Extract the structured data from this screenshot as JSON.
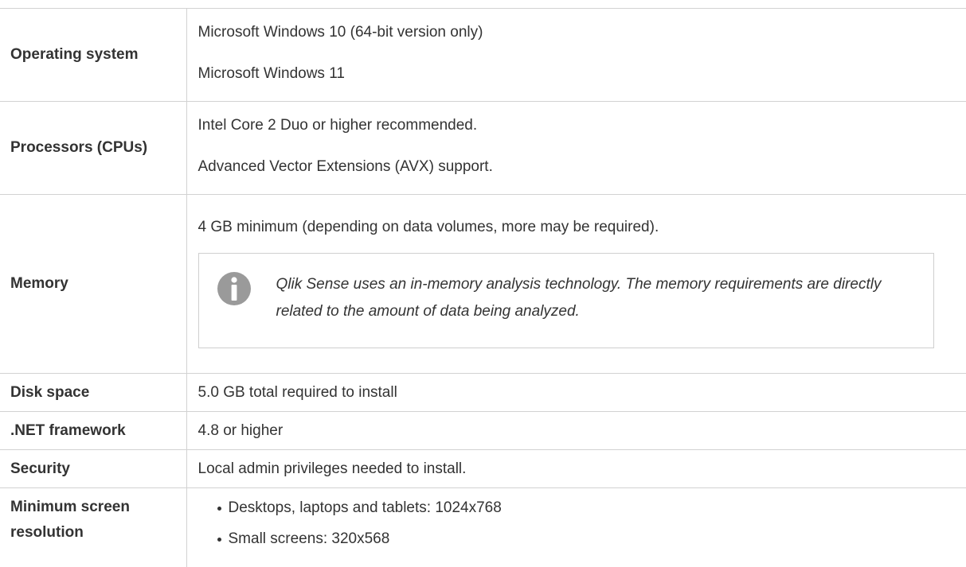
{
  "requirements": {
    "os": {
      "label": "Operating system",
      "values": [
        "Microsoft Windows 10 (64-bit version only)",
        "Microsoft Windows 11"
      ]
    },
    "cpu": {
      "label": "Processors (CPUs)",
      "values": [
        "Intel Core 2 Duo or higher recommended.",
        "Advanced Vector Extensions (AVX) support."
      ]
    },
    "memory": {
      "label": "Memory",
      "value": "4 GB minimum (depending on data volumes, more may be required).",
      "note": "Qlik Sense uses an in-memory analysis technology. The memory requirements are directly related to the amount of data being analyzed.",
      "note_icon": "info-icon"
    },
    "disk": {
      "label": "Disk space",
      "value": "5.0 GB total required to install"
    },
    "dotnet": {
      "label": ".NET framework",
      "value": "4.8 or higher"
    },
    "security": {
      "label": "Security",
      "value": "Local admin privileges needed to install."
    },
    "screen": {
      "label": "Minimum screen resolution",
      "values": [
        "Desktops, laptops and tablets: 1024x768",
        "Small screens: 320x568"
      ]
    }
  },
  "colors": {
    "border": "#d2d2d2",
    "text": "#333333",
    "icon": "#999999"
  }
}
